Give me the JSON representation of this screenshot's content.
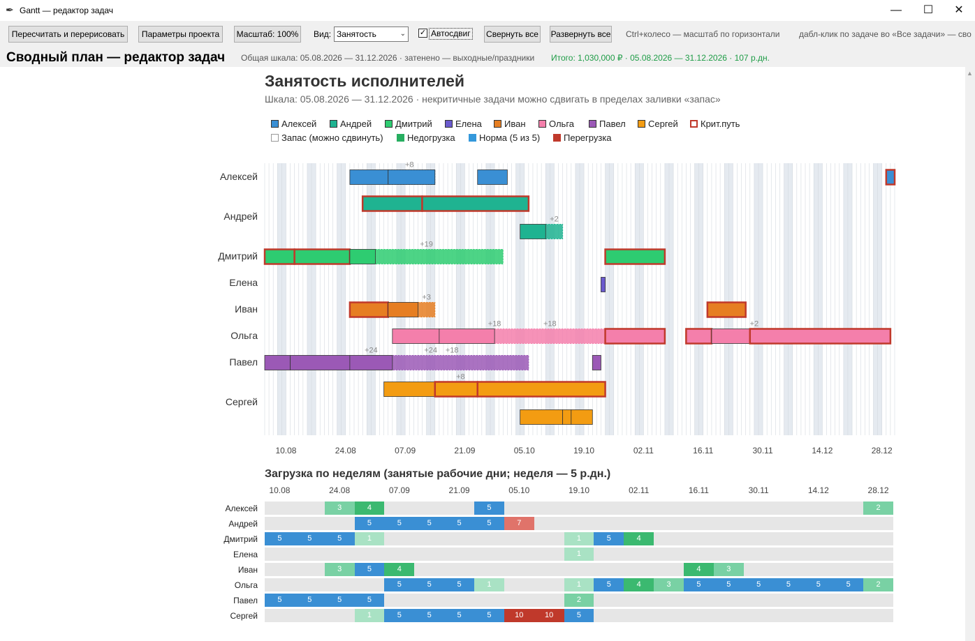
{
  "window": {
    "title": "Gantt — редактор задач",
    "icon": "feather-icon",
    "controls": {
      "minimize": "—",
      "maximize": "☐",
      "close": "✕"
    }
  },
  "toolbar": {
    "recalc_label": "Пересчитать и перерисовать",
    "params_label": "Параметры проекта",
    "scale_label": "Масштаб: 100%",
    "view_label": "Вид:",
    "view_value": "Занятость",
    "autoshift_label": "Автосдвиг",
    "autoshift_checked": true,
    "collapse_label": "Свернуть все",
    "expand_label": "Развернуть все",
    "hint_zoom": "Ctrl+колесо — масштаб по горизонтали",
    "hint_dblclick": "дабл-клик по задаче во «Все задачи» — сво"
  },
  "header": {
    "app_title": "Сводный план — редактор задач",
    "scale_info": "Общая шкала: 05.08.2026 — 31.12.2026   ·   затенено — выходные/праздники",
    "totals": "Итого: 1,030,000 ₽   ·   05.08.2026 — 31.12.2026   ·   107 р.дн."
  },
  "chart_data": {
    "type": "gantt",
    "title": "Занятость исполнителей",
    "subtitle": "Шкала: 05.08.2026 — 31.12.2026 · некритичные задачи можно сдвигать в пределах заливки «запас»",
    "date_range": [
      "2026-08-05",
      "2026-12-31"
    ],
    "x_ticks": [
      "10.08",
      "24.08",
      "07.09",
      "21.09",
      "05.10",
      "19.10",
      "02.11",
      "16.11",
      "30.11",
      "14.12",
      "28.12"
    ],
    "legend_people": [
      {
        "name": "Алексей",
        "color": "#3a8fd4"
      },
      {
        "name": "Андрей",
        "color": "#1fb391"
      },
      {
        "name": "Дмитрий",
        "color": "#2ecc71"
      },
      {
        "name": "Елена",
        "color": "#6a5acd"
      },
      {
        "name": "Иван",
        "color": "#e67e22"
      },
      {
        "name": "Ольга",
        "color": "#f47fab"
      },
      {
        "name": "Павел",
        "color": "#9b59b6"
      },
      {
        "name": "Сергей",
        "color": "#f39c12"
      },
      {
        "name": "Крит.путь",
        "color": "#c0392b",
        "outline": true
      }
    ],
    "legend_load": [
      {
        "name": "Запас (можно сдвинуть)",
        "color": "#ffffff"
      },
      {
        "name": "Недогрузка",
        "color": "#27ae60"
      },
      {
        "name": "Норма (5 из 5)",
        "color": "#3498db"
      },
      {
        "name": "Перегрузка",
        "color": "#c0392b"
      }
    ],
    "people": [
      "Алексей",
      "Андрей",
      "Дмитрий",
      "Елена",
      "Иван",
      "Ольга",
      "Павел",
      "Сергей"
    ],
    "tasks": [
      {
        "person": "Алексей",
        "lane": 0,
        "start": "2026-08-25",
        "end": "2026-09-03",
        "crit": false
      },
      {
        "person": "Алексей",
        "lane": 0,
        "start": "2026-09-03",
        "end": "2026-09-14",
        "crit": false,
        "slack": 8
      },
      {
        "person": "Алексей",
        "lane": 0,
        "start": "2026-09-24",
        "end": "2026-10-01",
        "crit": false
      },
      {
        "person": "Алексей",
        "lane": 0,
        "start": "2026-12-29",
        "end": "2026-12-31",
        "crit": true
      },
      {
        "person": "Андрей",
        "lane": 0,
        "start": "2026-08-28",
        "end": "2026-09-11",
        "crit": true
      },
      {
        "person": "Андрей",
        "lane": 0,
        "start": "2026-09-11",
        "end": "2026-10-06",
        "crit": true
      },
      {
        "person": "Андрей",
        "lane": 1,
        "start": "2026-10-04",
        "end": "2026-10-10",
        "crit": false,
        "slack": 2
      },
      {
        "person": "Дмитрий",
        "lane": 0,
        "start": "2026-08-05",
        "end": "2026-08-12",
        "crit": true
      },
      {
        "person": "Дмитрий",
        "lane": 0,
        "start": "2026-08-12",
        "end": "2026-08-25",
        "crit": true
      },
      {
        "person": "Дмитрий",
        "lane": 0,
        "start": "2026-08-25",
        "end": "2026-08-31",
        "crit": false,
        "slack": 19
      },
      {
        "person": "Дмитрий",
        "lane": 0,
        "start": "2026-10-24",
        "end": "2026-11-07",
        "crit": true
      },
      {
        "person": "Елена",
        "lane": 0,
        "start": "2026-10-23",
        "end": "2026-10-24",
        "crit": false
      },
      {
        "person": "Иван",
        "lane": 0,
        "start": "2026-08-25",
        "end": "2026-09-03",
        "crit": true
      },
      {
        "person": "Иван",
        "lane": 0,
        "start": "2026-09-03",
        "end": "2026-09-10",
        "crit": false,
        "slack": 3
      },
      {
        "person": "Иван",
        "lane": 0,
        "start": "2026-11-17",
        "end": "2026-11-26",
        "crit": true
      },
      {
        "person": "Ольга",
        "lane": 0,
        "start": "2026-09-04",
        "end": "2026-09-15",
        "crit": false
      },
      {
        "person": "Ольга",
        "lane": 0,
        "start": "2026-09-15",
        "end": "2026-09-28",
        "crit": false,
        "slack": 18
      },
      {
        "person": "Ольга",
        "lane": 0,
        "start": "2026-10-24",
        "end": "2026-11-07",
        "crit": true
      },
      {
        "person": "Ольга",
        "lane": 0,
        "start": "2026-11-12",
        "end": "2026-11-18",
        "crit": true
      },
      {
        "person": "Ольга",
        "lane": 0,
        "start": "2026-11-18",
        "end": "2026-11-27",
        "crit": false,
        "slack": 2
      },
      {
        "person": "Ольга",
        "lane": 0,
        "start": "2026-11-27",
        "end": "2026-12-30",
        "crit": true
      },
      {
        "person": "Павел",
        "lane": 0,
        "start": "2026-08-05",
        "end": "2026-08-11",
        "crit": false
      },
      {
        "person": "Павел",
        "lane": 0,
        "start": "2026-08-11",
        "end": "2026-08-25",
        "crit": false,
        "slack": 24
      },
      {
        "person": "Павел",
        "lane": 0,
        "start": "2026-08-25",
        "end": "2026-09-04",
        "crit": false,
        "slack": 18
      },
      {
        "person": "Павел",
        "lane": 0,
        "start": "2026-10-21",
        "end": "2026-10-23",
        "crit": false
      },
      {
        "person": "Сергей",
        "lane": 0,
        "start": "2026-09-02",
        "end": "2026-09-14",
        "crit": false
      },
      {
        "person": "Сергей",
        "lane": 0,
        "start": "2026-09-14",
        "end": "2026-09-24",
        "crit": true,
        "slack": 8
      },
      {
        "person": "Сергей",
        "lane": 0,
        "start": "2026-09-24",
        "end": "2026-10-24",
        "crit": true
      },
      {
        "person": "Сергей",
        "lane": 1,
        "start": "2026-10-04",
        "end": "2026-10-14",
        "crit": false
      },
      {
        "person": "Сергей",
        "lane": 1,
        "start": "2026-10-14",
        "end": "2026-10-16",
        "crit": false
      },
      {
        "person": "Сергей",
        "lane": 1,
        "start": "2026-10-16",
        "end": "2026-10-21",
        "crit": false
      }
    ],
    "slack_fills": [
      {
        "person": "Алексей",
        "lane": 0,
        "start": "2026-09-03",
        "end": "2026-09-14"
      },
      {
        "person": "Андрей",
        "lane": 1,
        "start": "2026-10-10",
        "end": "2026-10-14"
      },
      {
        "person": "Дмитрий",
        "lane": 0,
        "start": "2026-08-31",
        "end": "2026-09-30"
      },
      {
        "person": "Иван",
        "lane": 0,
        "start": "2026-09-10",
        "end": "2026-09-14"
      },
      {
        "person": "Ольга",
        "lane": 0,
        "start": "2026-09-28",
        "end": "2026-10-24"
      },
      {
        "person": "Павел",
        "lane": 0,
        "start": "2026-09-04",
        "end": "2026-10-06"
      }
    ],
    "slack_labels": [
      {
        "person": "Алексей",
        "lane": 0,
        "date": "2026-09-08",
        "text": "+8"
      },
      {
        "person": "Андрей",
        "lane": 1,
        "date": "2026-10-12",
        "text": "+2"
      },
      {
        "person": "Дмитрий",
        "lane": 0,
        "date": "2026-09-12",
        "text": "+19"
      },
      {
        "person": "Иван",
        "lane": 0,
        "date": "2026-09-12",
        "text": "+3"
      },
      {
        "person": "Ольга",
        "lane": 0,
        "date": "2026-09-28",
        "text": "+18"
      },
      {
        "person": "Ольга",
        "lane": 0,
        "date": "2026-10-11",
        "text": "+18"
      },
      {
        "person": "Ольга",
        "lane": 0,
        "date": "2026-11-28",
        "text": "+2"
      },
      {
        "person": "Павел",
        "lane": 0,
        "date": "2026-08-30",
        "text": "+24"
      },
      {
        "person": "Павел",
        "lane": 0,
        "date": "2026-09-13",
        "text": "+24"
      },
      {
        "person": "Павел",
        "lane": 0,
        "date": "2026-09-18",
        "text": "+18"
      },
      {
        "person": "Сергей",
        "lane": 0,
        "date": "2026-09-20",
        "text": "+8"
      }
    ]
  },
  "load": {
    "title": "Загрузка по неделям (занятые рабочие дни; неделя — 5 р.дн.)",
    "week_ticks": [
      "10.08",
      "24.08",
      "07.09",
      "21.09",
      "05.10",
      "19.10",
      "02.11",
      "16.11",
      "30.11",
      "14.12",
      "28.12"
    ],
    "weeks": 21,
    "colors": {
      "1": "#a9e2c4",
      "2": "#79d1a4",
      "3": "#79d1a4",
      "4": "#3bb970",
      "5": "#3a8fd4",
      "7": "#e0736a",
      "10": "#c0392b"
    },
    "rows": [
      {
        "name": "Алексей",
        "cells": [
          null,
          null,
          3,
          4,
          null,
          null,
          null,
          5,
          null,
          null,
          null,
          null,
          null,
          null,
          null,
          null,
          null,
          null,
          null,
          null,
          2
        ]
      },
      {
        "name": "Андрей",
        "cells": [
          null,
          null,
          null,
          5,
          5,
          5,
          5,
          5,
          7,
          null,
          null,
          null,
          null,
          null,
          null,
          null,
          null,
          null,
          null,
          null,
          null
        ]
      },
      {
        "name": "Дмитрий",
        "cells": [
          5,
          5,
          5,
          1,
          null,
          null,
          null,
          null,
          null,
          null,
          1,
          5,
          4,
          null,
          null,
          null,
          null,
          null,
          null,
          null,
          null
        ]
      },
      {
        "name": "Елена",
        "cells": [
          null,
          null,
          null,
          null,
          null,
          null,
          null,
          null,
          null,
          null,
          1,
          null,
          null,
          null,
          null,
          null,
          null,
          null,
          null,
          null,
          null
        ]
      },
      {
        "name": "Иван",
        "cells": [
          null,
          null,
          3,
          5,
          4,
          null,
          null,
          null,
          null,
          null,
          null,
          null,
          null,
          null,
          4,
          3,
          null,
          null,
          null,
          null,
          null
        ]
      },
      {
        "name": "Ольга",
        "cells": [
          null,
          null,
          null,
          null,
          5,
          5,
          5,
          1,
          null,
          null,
          1,
          5,
          4,
          3,
          5,
          5,
          5,
          5,
          5,
          5,
          2
        ]
      },
      {
        "name": "Павел",
        "cells": [
          5,
          5,
          5,
          5,
          null,
          null,
          null,
          null,
          null,
          null,
          2,
          null,
          null,
          null,
          null,
          null,
          null,
          null,
          null,
          null,
          null
        ]
      },
      {
        "name": "Сергей",
        "cells": [
          null,
          null,
          null,
          1,
          5,
          5,
          5,
          5,
          10,
          10,
          5,
          null,
          null,
          null,
          null,
          null,
          null,
          null,
          null,
          null,
          null
        ]
      }
    ]
  }
}
